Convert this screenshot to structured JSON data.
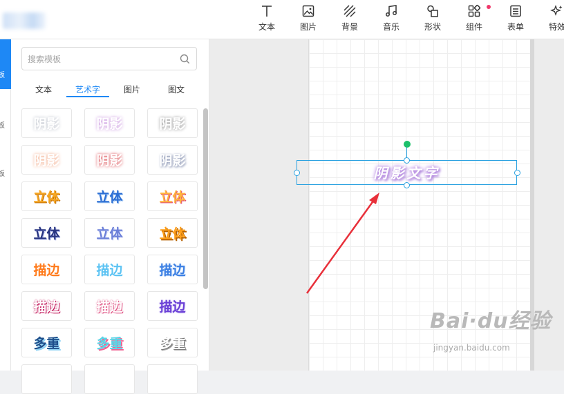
{
  "toolbar": {
    "items": [
      {
        "label": "文本",
        "icon": "text-icon"
      },
      {
        "label": "图片",
        "icon": "image-icon"
      },
      {
        "label": "背景",
        "icon": "background-icon"
      },
      {
        "label": "音乐",
        "icon": "music-icon"
      },
      {
        "label": "形状",
        "icon": "shape-icon"
      },
      {
        "label": "组件",
        "icon": "component-icon"
      },
      {
        "label": "表单",
        "icon": "form-icon"
      },
      {
        "label": "特效",
        "icon": "effects-icon"
      }
    ]
  },
  "sidebar": {
    "items": [
      {
        "label": "板",
        "active": true
      },
      {
        "label": "板"
      },
      {
        "label": "板"
      }
    ]
  },
  "panel": {
    "search_placeholder": "搜索模板",
    "tabs": [
      {
        "label": "文本"
      },
      {
        "label": "艺术字",
        "active": true
      },
      {
        "label": "图片"
      },
      {
        "label": "图文"
      }
    ],
    "tiles": [
      {
        "label": "阴影",
        "color": "#ffffff",
        "shadow": "0 0 5px #b9bec8"
      },
      {
        "label": "阴影",
        "color": "#ffffff",
        "shadow": "0 0 5px #c48cdb"
      },
      {
        "label": "阴影",
        "color": "#ffffff",
        "shadow": "0 0 4px #8d8d8d"
      },
      {
        "label": "阴影",
        "color": "#ffffff",
        "shadow": "0 0 5px #f2a987"
      },
      {
        "label": "阴影",
        "color": "#ffffff",
        "shadow": "0 0 4px #d9434a"
      },
      {
        "label": "阴影",
        "color": "#ffffff",
        "shadow": "1px 1px 3px #6d7aa0"
      },
      {
        "label": "立体",
        "color": "#f5a623",
        "shadow": "1px 1px 0 #c36d00"
      },
      {
        "label": "立体",
        "color": "#2d6fd4",
        "shadow": "1px 1px 0 #9ec5f3"
      },
      {
        "label": "立体",
        "color": "#ffb43c",
        "shadow": "1px 1px 0 #e0487a"
      },
      {
        "label": "立体",
        "color": "#27337f",
        "shadow": "1px 1px 0 #9aa5e6"
      },
      {
        "label": "立体",
        "color": "#6b7fd8",
        "shadow": "1px 1px 0 #cfd6f7"
      },
      {
        "label": "立体",
        "color": "#ff9f1a",
        "shadow": "2px 2px 0 #b56100"
      },
      {
        "label": "描边",
        "color": "#ff7a1a",
        "shadow": "0 0 1px #ffffff"
      },
      {
        "label": "描边",
        "color": "#5cc3f3",
        "shadow": "0 0 2px #ffffff"
      },
      {
        "label": "描边",
        "color": "#3b7fe3",
        "shadow": "0 0 2px #bcd7f8"
      },
      {
        "label": "描边",
        "color": "#ffffff",
        "shadow": "0 0 2px #c2185b, 1px 1px 0 #c2185b"
      },
      {
        "label": "描边",
        "color": "#ffffff",
        "shadow": "0 0 2px #e05585, 1px 1px 0 #e05585"
      },
      {
        "label": "描边",
        "color": "#6a3fd6",
        "shadow": "0 0 2px #c0b0f2"
      },
      {
        "label": "多重",
        "color": "#1d4f8c",
        "shadow": "2px 2px 0 #8fd3f5"
      },
      {
        "label": "多重",
        "color": "#5ad4e6",
        "shadow": "2px 2px 0 #f06292"
      },
      {
        "label": "多重",
        "color": "#ffffff",
        "shadow": "1px 1px 0 #777777, 2px 2px 0 #aaaaaa"
      },
      {
        "label": "",
        "color": "#ffffff",
        "shadow": "none"
      },
      {
        "label": "",
        "color": "#ffffff",
        "shadow": "none"
      },
      {
        "label": "",
        "color": "#ffffff",
        "shadow": "none"
      }
    ]
  },
  "canvas": {
    "selected_text": "阴影文字"
  },
  "watermark": {
    "main": "Bai·du经验",
    "sub": "jingyan.baidu.com"
  },
  "colors": {
    "accent": "#1e88f5",
    "selection": "#29a1e0",
    "rotate_handle": "#1cc06b",
    "arrow": "#e8303a",
    "notification_dot": "#f0386b"
  }
}
